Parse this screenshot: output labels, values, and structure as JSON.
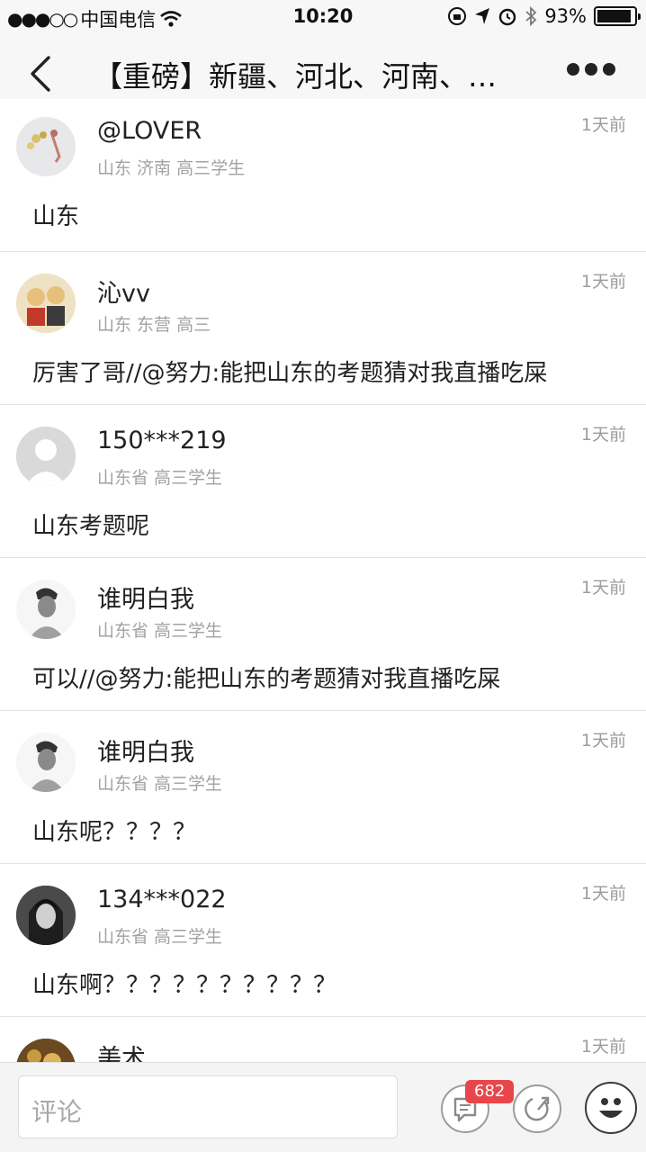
{
  "status_bar": {
    "carrier": "中国电信",
    "time": "10:20",
    "battery": "93%",
    "battery_level": 0.93
  },
  "nav": {
    "title": "【重磅】新疆、河北、河南、…",
    "back_icon": "chevron-left-icon",
    "more_icon": "more-dots-icon"
  },
  "comments": [
    {
      "name": "@LOVER",
      "meta": "山东 济南 高三学生",
      "time": "1天前",
      "text": "山东"
    },
    {
      "name": "沁vv",
      "meta": "山东 东营 高三",
      "time": "1天前",
      "text": "厉害了哥//@努力:能把山东的考题猜对我直播吃屎"
    },
    {
      "name": "150***219",
      "meta": "山东省 高三学生",
      "time": "1天前",
      "text": "山东考题呢"
    },
    {
      "name": "谁明白我",
      "meta": "山东省 高三学生",
      "time": "1天前",
      "text": "可以//@努力:能把山东的考题猜对我直播吃屎"
    },
    {
      "name": "谁明白我",
      "meta": "山东省 高三学生",
      "time": "1天前",
      "text": "山东呢？？？？"
    },
    {
      "name": "134***022",
      "meta": "山东省 高三学生",
      "time": "1天前",
      "text": "山东啊？？？？？？？？？？"
    },
    {
      "name": "美术",
      "meta": "",
      "time": "1天前",
      "text": ""
    }
  ],
  "bottom_bar": {
    "input_placeholder": "评论",
    "comment_count": "682"
  }
}
